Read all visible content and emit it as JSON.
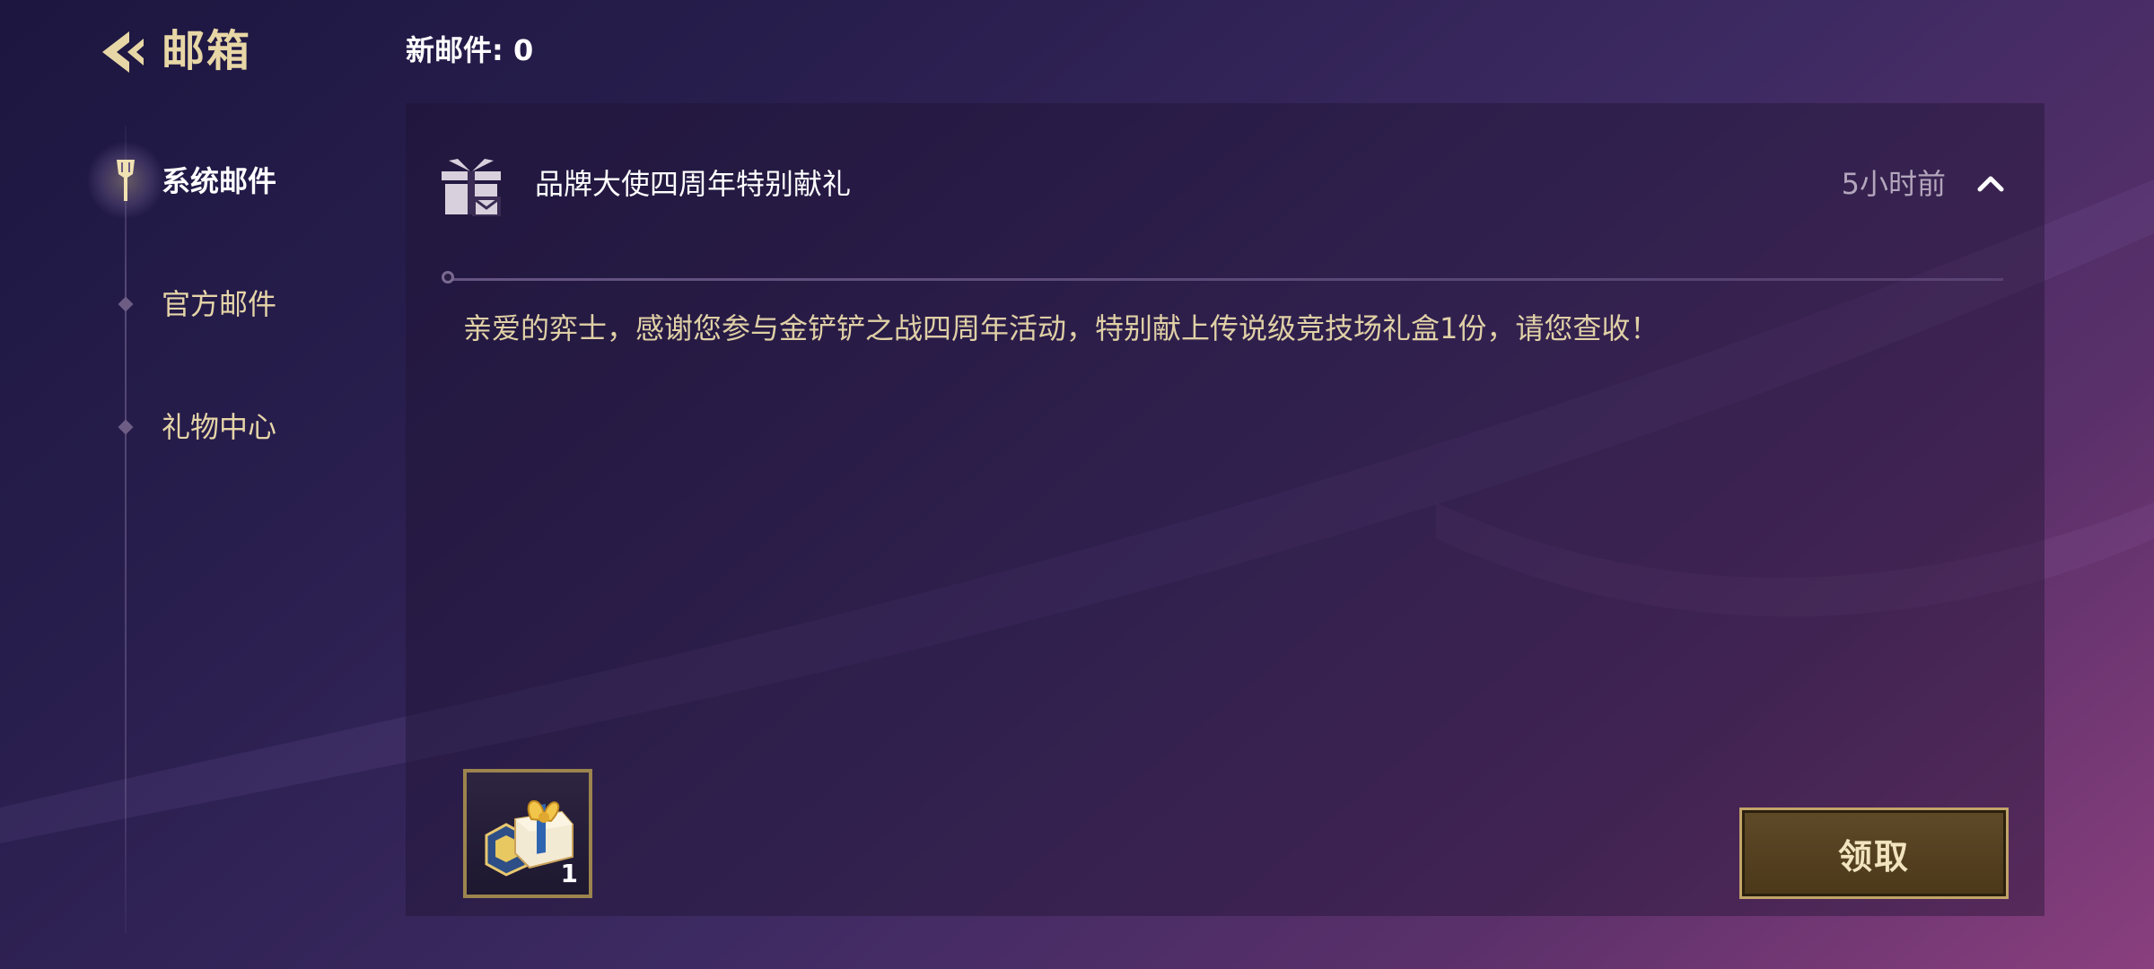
{
  "header": {
    "title": "邮箱",
    "new_mail": "新邮件: 0"
  },
  "sidebar": {
    "items": [
      {
        "label": "系统邮件",
        "active": true
      },
      {
        "label": "官方邮件",
        "active": false
      },
      {
        "label": "礼物中心",
        "active": false
      }
    ]
  },
  "mail": {
    "subject": "品牌大使四周年特别献礼",
    "time": "5小时前",
    "body": "亲爱的弈士，感谢您参与金铲铲之战四周年活动，特别献上传说级竞技场礼盒1份，请您查收！",
    "reward": {
      "icon": "gift-box-icon",
      "count": "1"
    },
    "claim_label": "领取"
  },
  "colors": {
    "accent_gold": "#e8d7a6",
    "button_bg": "#5f4a28",
    "button_border": "#c2a468"
  }
}
